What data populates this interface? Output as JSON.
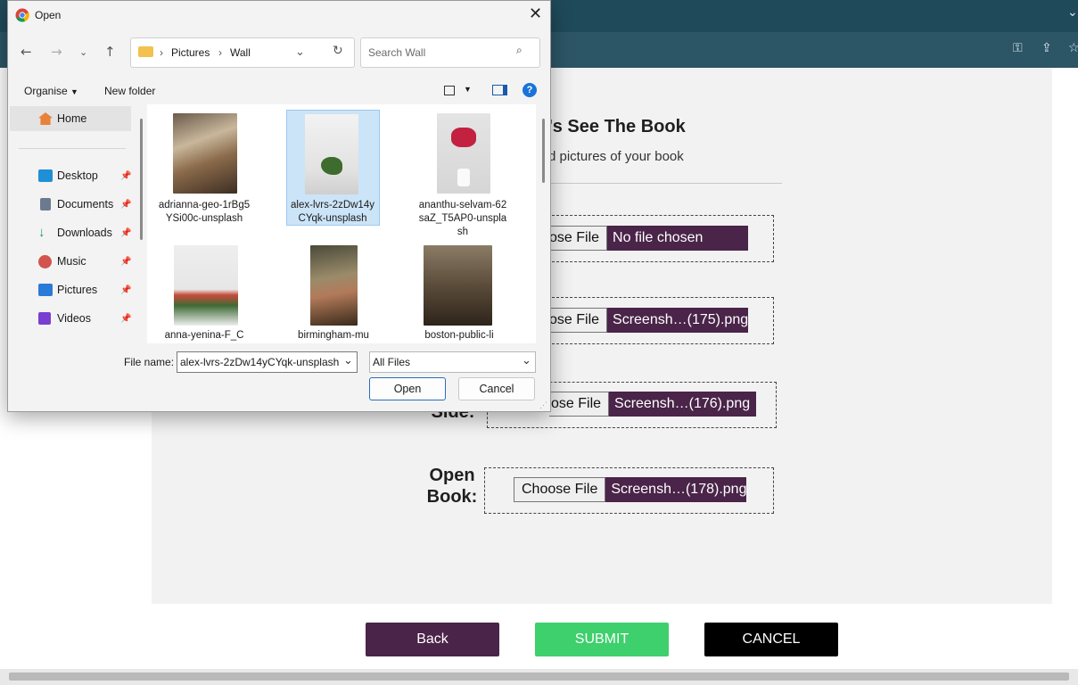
{
  "dialog": {
    "title": "Open",
    "breadcrumb": [
      "Pictures",
      "Wall"
    ],
    "search_placeholder": "Search Wall",
    "organise_label": "Organise",
    "new_folder_label": "New folder",
    "sidebar": [
      {
        "label": "Home",
        "icon": "home-icon",
        "color": "#e8823a"
      },
      {
        "label": "Desktop",
        "icon": "desktop-icon",
        "color": "#1f8fd6"
      },
      {
        "label": "Documents",
        "icon": "documents-icon",
        "color": "#6b7a8f"
      },
      {
        "label": "Downloads",
        "icon": "downloads-icon",
        "color": "#1c9a5b"
      },
      {
        "label": "Music",
        "icon": "music-icon",
        "color": "#d1544f"
      },
      {
        "label": "Pictures",
        "icon": "pictures-icon",
        "color": "#2a7ad8"
      },
      {
        "label": "Videos",
        "icon": "videos-icon",
        "color": "#7a3ed0"
      }
    ],
    "files": [
      {
        "name": "adrianna-geo-1rBg5YSi00c-unsplash",
        "selected": false
      },
      {
        "name": "alex-lvrs-2zDw14yCYqk-unsplash",
        "selected": true
      },
      {
        "name": "ananthu-selvam-62saZ_T5AP0-unsplash",
        "selected": false
      },
      {
        "name": "anna-yenina-F_C",
        "selected": false
      },
      {
        "name": "birmingham-mu",
        "selected": false
      },
      {
        "name": "boston-public-li",
        "selected": false
      }
    ],
    "file_name_label": "File name:",
    "file_name_value": "alex-lvrs-2zDw14yCYqk-unsplash",
    "file_type_value": "All Files",
    "open_label": "Open",
    "cancel_label": "Cancel"
  },
  "page": {
    "heading": "'s See The Book",
    "subheading": "d pictures of your book",
    "uploads": [
      {
        "label": "",
        "choose": "ose File",
        "file": "No file chosen"
      },
      {
        "label": "",
        "choose": "ose File",
        "file": "Screensh…(175).png"
      },
      {
        "label": "Side:",
        "choose": "ose File",
        "file": "Screensh…(176).png"
      },
      {
        "label": "Open Book:",
        "choose": "Choose File",
        "file": "Screensh…(178).png"
      }
    ],
    "buttons": {
      "back": "Back",
      "submit": "SUBMIT",
      "cancel": "CANCEL"
    }
  },
  "colors": {
    "back": "#4a2449",
    "submit": "#3dd06c",
    "cancel": "#000000",
    "file_name_bg": "#4a2449",
    "browser_bar": "#2c5566"
  }
}
